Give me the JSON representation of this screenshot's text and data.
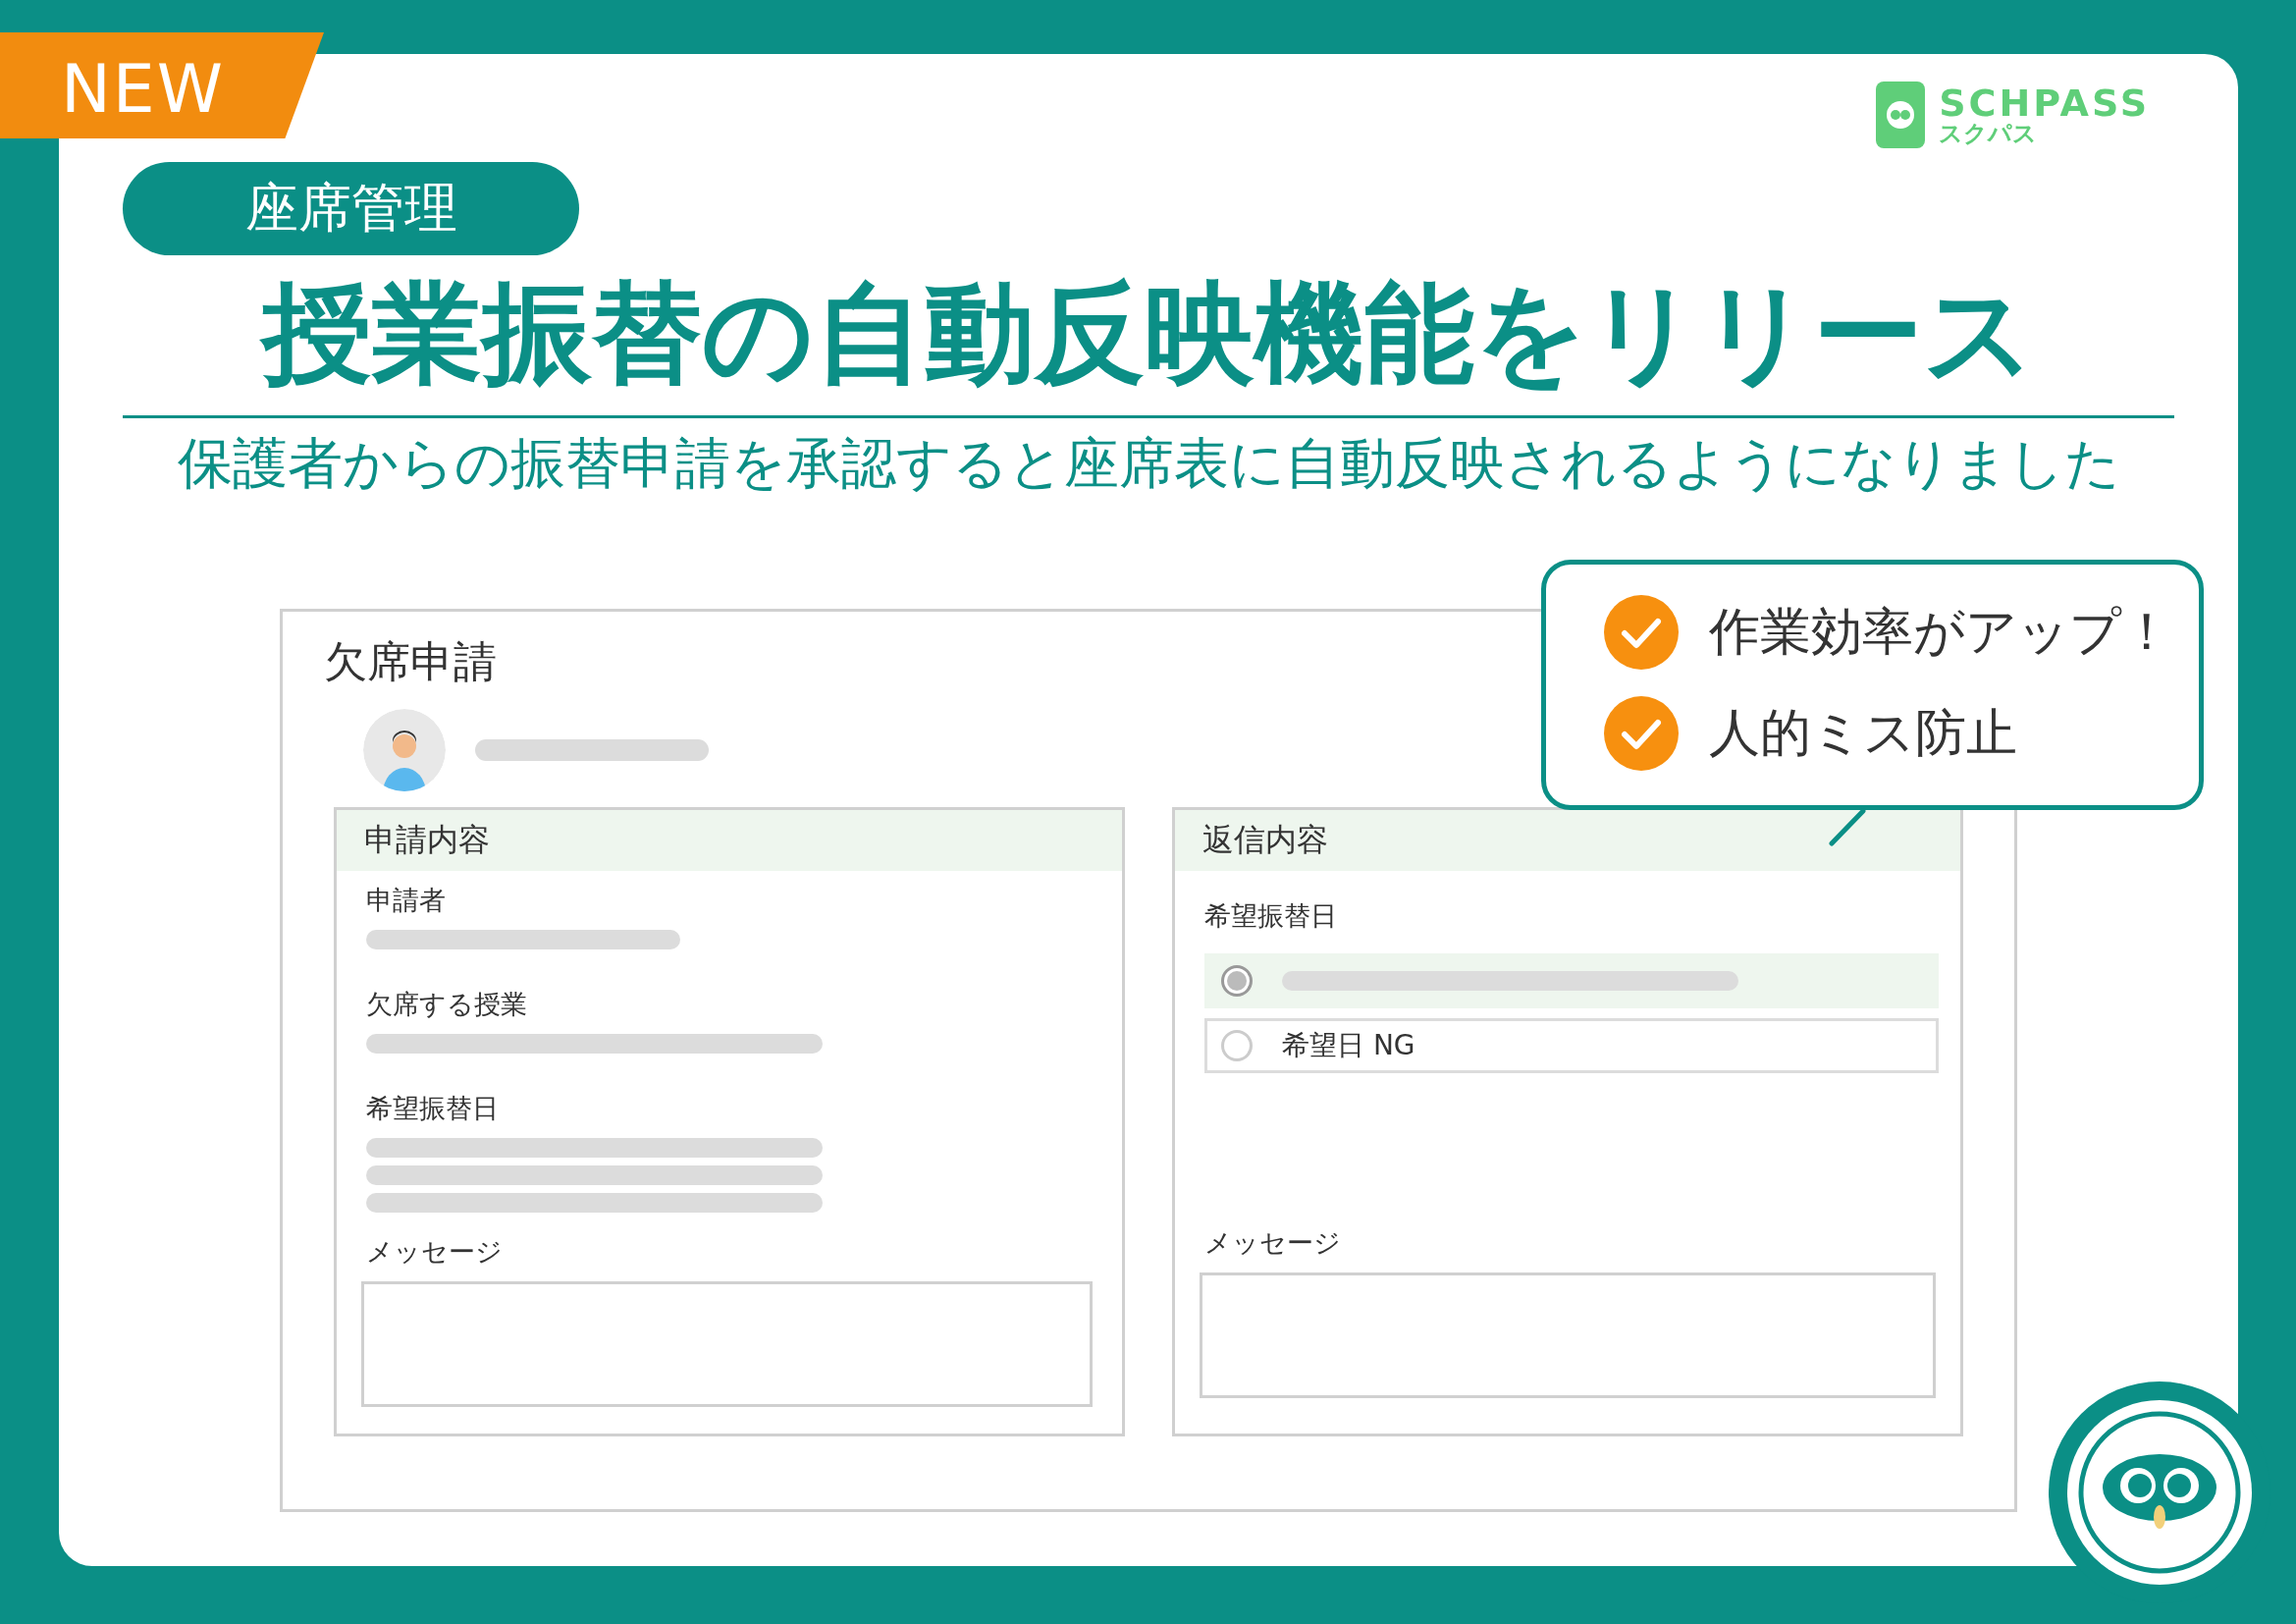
{
  "badge": "NEW",
  "logo": {
    "name": "SCHPASS",
    "kana": "スクパス"
  },
  "category": "座席管理",
  "title": "授業振替の自動反映機能をリリース",
  "subtitle": "保護者からの振替申請を承認すると座席表に自動反映されるようになりました",
  "mockup": {
    "title": "欠席申請",
    "request_panel": {
      "heading": "申請内容",
      "fields": [
        {
          "label": "申請者",
          "kind": "short"
        },
        {
          "label": "欠席する授業",
          "kind": "line"
        },
        {
          "label": "希望振替日",
          "kind": "lines"
        },
        {
          "label": "メッセージ",
          "kind": "box"
        }
      ]
    },
    "reply_panel": {
      "heading": "返信内容",
      "date_label": "希望振替日",
      "options": [
        {
          "kind": "placeholder",
          "selected": true
        },
        {
          "kind": "text",
          "label": "希望日 NG",
          "selected": false
        }
      ],
      "message_label": "メッセージ"
    }
  },
  "callout": {
    "points": [
      "作業効率がアップ！",
      "人的ミス防止"
    ]
  }
}
